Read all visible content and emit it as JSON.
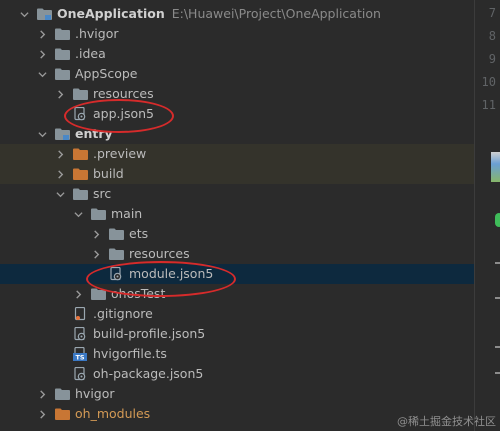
{
  "project": {
    "name": "OneApplication",
    "path": "E:\\Huawei\\Project\\OneApplication"
  },
  "tree": [
    {
      "label": "OneApplication",
      "kind": "module-folder",
      "depth": 0,
      "arrow": "down",
      "bold": true,
      "path": "E:\\Huawei\\Project\\OneApplication"
    },
    {
      "label": ".hvigor",
      "kind": "folder",
      "depth": 1,
      "arrow": "right"
    },
    {
      "label": ".idea",
      "kind": "folder",
      "depth": 1,
      "arrow": "right"
    },
    {
      "label": "AppScope",
      "kind": "folder",
      "depth": 1,
      "arrow": "down"
    },
    {
      "label": "resources",
      "kind": "folder",
      "depth": 2,
      "arrow": "right"
    },
    {
      "label": "app.json5",
      "kind": "json-file",
      "depth": 2,
      "arrow": "none",
      "circled": true
    },
    {
      "label": "entry",
      "kind": "module-folder",
      "depth": 1,
      "arrow": "down",
      "bold": true
    },
    {
      "label": ".preview",
      "kind": "orange-folder",
      "depth": 2,
      "arrow": "right",
      "tint": true
    },
    {
      "label": "build",
      "kind": "orange-folder",
      "depth": 2,
      "arrow": "right",
      "tint": true
    },
    {
      "label": "src",
      "kind": "folder",
      "depth": 2,
      "arrow": "down"
    },
    {
      "label": "main",
      "kind": "folder",
      "depth": 3,
      "arrow": "down"
    },
    {
      "label": "ets",
      "kind": "folder",
      "depth": 4,
      "arrow": "right"
    },
    {
      "label": "resources",
      "kind": "folder",
      "depth": 4,
      "arrow": "right"
    },
    {
      "label": "module.json5",
      "kind": "json-file",
      "depth": 4,
      "arrow": "none",
      "selected": true,
      "circled": true
    },
    {
      "label": "ohosTest",
      "kind": "folder",
      "depth": 3,
      "arrow": "right"
    },
    {
      "label": ".gitignore",
      "kind": "git-file",
      "depth": 2,
      "arrow": "none"
    },
    {
      "label": "build-profile.json5",
      "kind": "json-file",
      "depth": 2,
      "arrow": "none"
    },
    {
      "label": "hvigorfile.ts",
      "kind": "ts-file",
      "depth": 2,
      "arrow": "none"
    },
    {
      "label": "oh-package.json5",
      "kind": "json-file",
      "depth": 2,
      "arrow": "none"
    },
    {
      "label": "hvigor",
      "kind": "folder",
      "depth": 1,
      "arrow": "right"
    },
    {
      "label": "oh_modules",
      "kind": "orange-folder",
      "depth": 1,
      "arrow": "right",
      "orange": true
    }
  ],
  "line_numbers": [
    "7",
    "8",
    "9",
    "10",
    "11"
  ],
  "watermark": "@稀土掘金技术社区",
  "colors": {
    "background": "#2b2b2b",
    "selection": "#0d293e",
    "excluded_tint": "#34332b",
    "folder": "#87939a",
    "orange_folder": "#c87634",
    "annotation": "#d62b2b"
  }
}
